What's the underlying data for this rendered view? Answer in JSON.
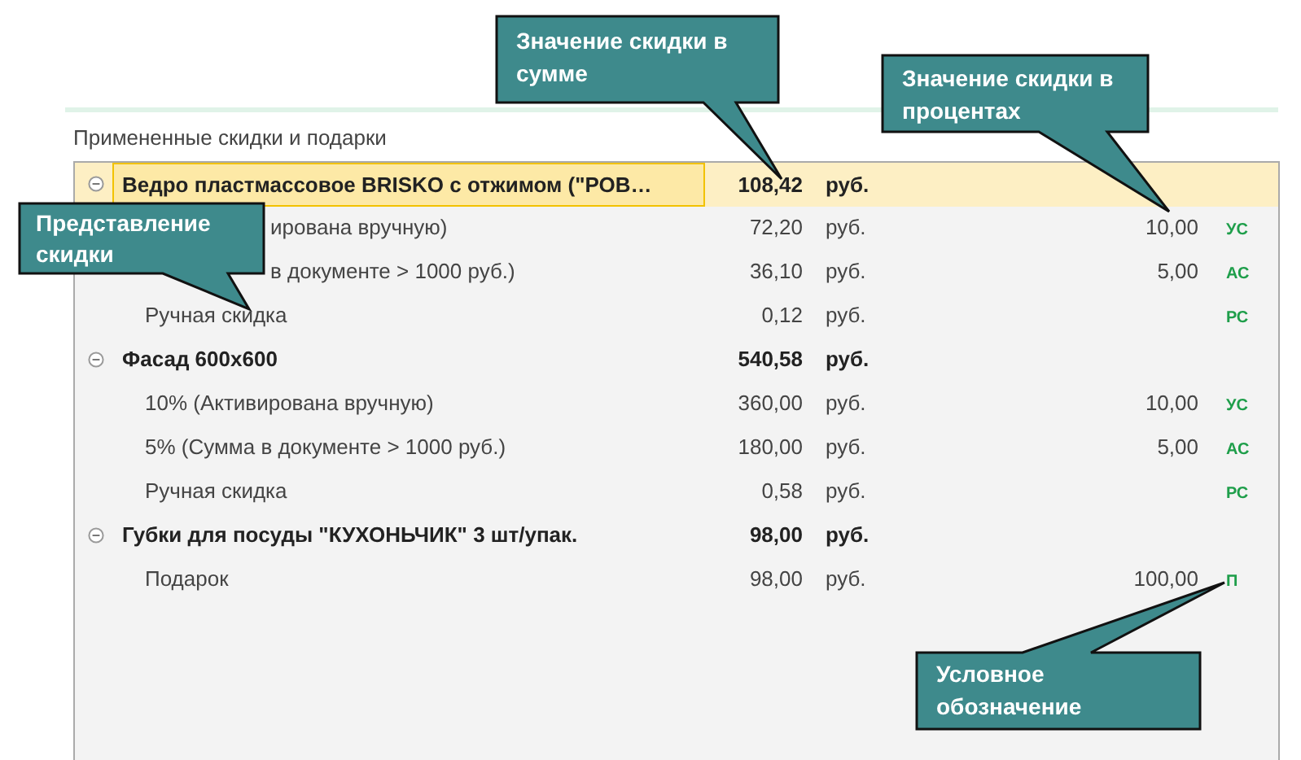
{
  "section_title": "Примененные скидки и подарки",
  "items": [
    {
      "label": "Ведро пластмассовое BRISKO с отжимом (\"РОВ…",
      "amount": "108,42",
      "currency": "руб.",
      "selected": true,
      "expanded": true,
      "children": [
        {
          "kind": "obscured",
          "label": "ирована вручную)",
          "amount": "72,20",
          "currency": "руб.",
          "percent": "10,00",
          "code": "УС"
        },
        {
          "kind": "obscured",
          "label": "в документе > 1000 руб.)",
          "amount": "36,10",
          "currency": "руб.",
          "percent": "5,00",
          "code": "АС"
        },
        {
          "kind": "plain",
          "label": "Ручная скидка",
          "amount": "0,12",
          "currency": "руб.",
          "code": "РС"
        }
      ]
    },
    {
      "label": "Фасад 600x600",
      "amount": "540,58",
      "currency": "руб.",
      "selected": false,
      "expanded": true,
      "children": [
        {
          "kind": "plain",
          "label": "10% (Активирована вручную)",
          "amount": "360,00",
          "currency": "руб.",
          "percent": "10,00",
          "code": "УС"
        },
        {
          "kind": "plain",
          "label": "5% (Сумма в документе > 1000 руб.)",
          "amount": "180,00",
          "currency": "руб.",
          "percent": "5,00",
          "code": "АС"
        },
        {
          "kind": "plain",
          "label": "Ручная скидка",
          "amount": "0,58",
          "currency": "руб.",
          "code": "РС"
        }
      ]
    },
    {
      "label": "Губки для посуды \"КУХОНЬЧИК\" 3 шт/упак.",
      "amount": "98,00",
      "currency": "руб.",
      "selected": false,
      "expanded": true,
      "children": [
        {
          "kind": "plain",
          "label": "Подарок",
          "amount": "98,00",
          "currency": "руб.",
          "percent": "100,00",
          "code": "П"
        }
      ]
    }
  ],
  "callouts": [
    {
      "text": "Значение скидки в сумме"
    },
    {
      "text": "Значение скидки в процентах"
    },
    {
      "text": "Представление скидки"
    },
    {
      "text": "Условное обозначение"
    }
  ]
}
